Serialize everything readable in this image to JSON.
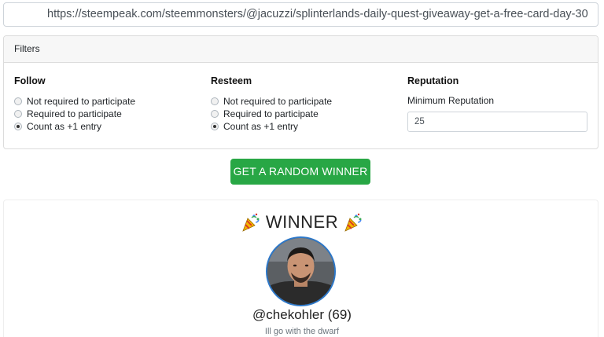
{
  "url_bar": {
    "value": "https://steempeak.com/steemmonsters/@jacuzzi/splinterlands-daily-quest-giveaway-get-a-free-card-day-30"
  },
  "filters": {
    "header": "Filters",
    "follow": {
      "title": "Follow",
      "options": [
        "Not required to participate",
        "Required to participate",
        "Count as +1 entry"
      ],
      "selected": "Count as +1 entry"
    },
    "resteem": {
      "title": "Resteem",
      "options": [
        "Not required to participate",
        "Required to participate",
        "Count as +1 entry"
      ],
      "selected": "Count as +1 entry"
    },
    "reputation": {
      "title": "Reputation",
      "label": "Minimum Reputation",
      "value": "25"
    }
  },
  "action_button": {
    "label": "GET A RANDOM WINNER",
    "color": "#28a745"
  },
  "winner": {
    "title": "WINNER",
    "icon": "party-popper-icon",
    "username": "@chekohler (69)",
    "comment": "Ill go with the dwarf",
    "avatar_border_color": "#2d78c9"
  }
}
